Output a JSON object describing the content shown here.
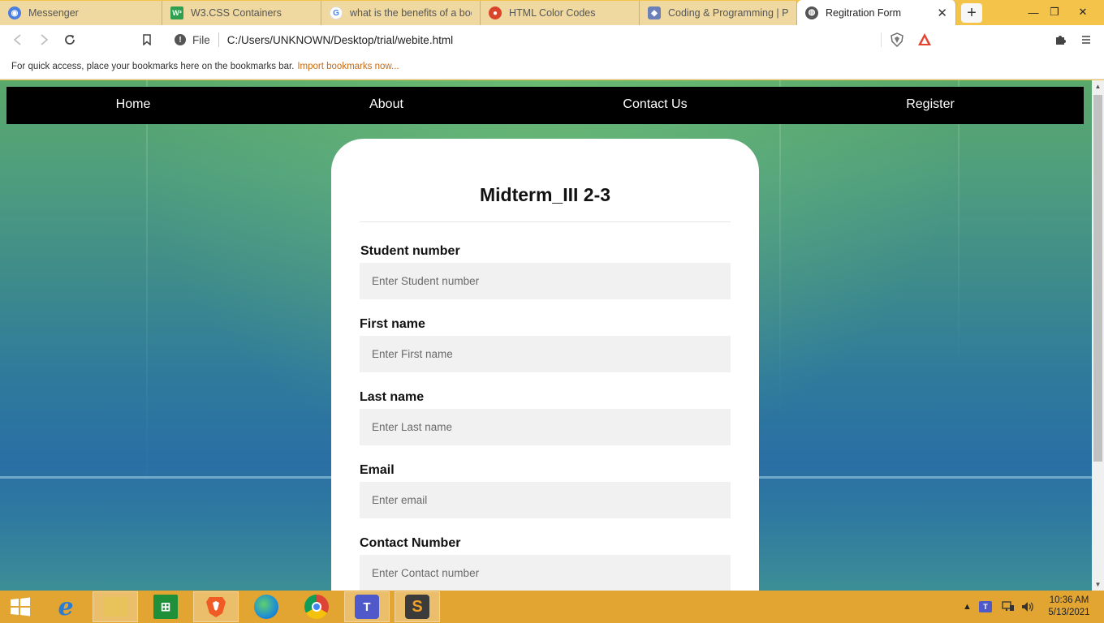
{
  "browser": {
    "tabs": [
      {
        "title": "Messenger",
        "icon": "messenger-icon",
        "color": "#4a7ee0",
        "active": false
      },
      {
        "title": "W3.CSS Containers",
        "icon": "w3schools-icon",
        "color": "#2e9e4f",
        "active": false
      },
      {
        "title": "what is the benefits of a boots",
        "icon": "google-icon",
        "color": "#4285f4",
        "active": false
      },
      {
        "title": "HTML Color Codes",
        "icon": "htmlcolor-icon",
        "color": "#d9442b",
        "active": false
      },
      {
        "title": "Coding & Programming | Pint",
        "icon": "pinterest-icon",
        "color": "#6b7fb8",
        "active": false
      },
      {
        "title": "Regitration Form",
        "icon": "globe-icon",
        "color": "#555555",
        "active": true
      }
    ],
    "new_tab_label": "+",
    "close_tab_label": "✕",
    "window_controls": {
      "minimize": "—",
      "restore": "❐",
      "close": "✕"
    },
    "address": {
      "scheme_label": "File",
      "url": "C:/Users/UNKNOWN/Desktop/trial/webite.html"
    },
    "bookmarks_bar": {
      "message": "For quick access, place your bookmarks here on the bookmarks bar.",
      "import_link": "Import bookmarks now..."
    }
  },
  "page": {
    "nav": [
      "Home",
      "About",
      "Contact Us",
      "Register"
    ],
    "form": {
      "title": "Midterm_III 2-3",
      "fields": [
        {
          "label": "Student number",
          "placeholder": "Enter Student number"
        },
        {
          "label": "First name",
          "placeholder": "Enter First name"
        },
        {
          "label": "Last name",
          "placeholder": "Enter Last name"
        },
        {
          "label": "Email",
          "placeholder": "Enter email"
        },
        {
          "label": "Contact Number",
          "placeholder": "Enter Contact number"
        }
      ]
    }
  },
  "taskbar": {
    "apps": [
      {
        "name": "internet-explorer-icon",
        "label": "e",
        "color": "#2a7bd4",
        "open": false
      },
      {
        "name": "file-explorer-icon",
        "label": "",
        "color": "#e8c25a",
        "open": true
      },
      {
        "name": "store-icon",
        "label": "",
        "color": "#1f8f3a",
        "open": false
      },
      {
        "name": "brave-icon",
        "label": "",
        "color": "#f05a24",
        "open": true
      },
      {
        "name": "edge-icon",
        "label": "",
        "color": "#1f8fd6",
        "open": false
      },
      {
        "name": "chrome-icon",
        "label": "",
        "color": "#db4437",
        "open": false
      },
      {
        "name": "teams-icon",
        "label": "T",
        "color": "#5059c9",
        "open": true
      },
      {
        "name": "sublime-icon",
        "label": "S",
        "color": "#f29f26",
        "open": true
      }
    ],
    "clock": {
      "time": "10:36 AM",
      "date": "5/13/2021"
    }
  }
}
